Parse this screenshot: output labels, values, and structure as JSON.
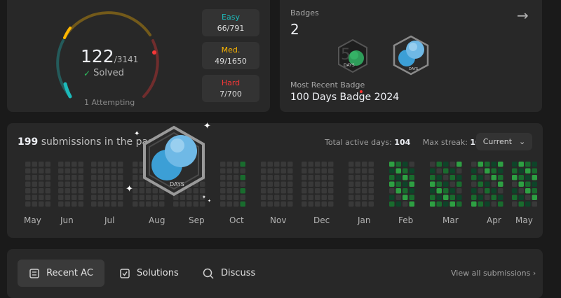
{
  "solved": {
    "count": "122",
    "total": "/3141",
    "label": "Solved",
    "attempting": "1 Attempting"
  },
  "difficulty": [
    {
      "label": "Easy",
      "value": "66/791",
      "color": "#1cbaba"
    },
    {
      "label": "Med.",
      "value": "49/1650",
      "color": "#ffb700"
    },
    {
      "label": "Hard",
      "value": "7/700",
      "color": "#f63737"
    }
  ],
  "badges": {
    "title": "Badges",
    "count": "2",
    "recent_label": "Most Recent Badge",
    "recent_name": "100 Days Badge 2024",
    "badge_text": "DAYS"
  },
  "calendar": {
    "count": "199",
    "text": "submissions in the past",
    "active_label": "Total active days:",
    "active_value": "104",
    "streak_label": "Max streak:",
    "streak_value": "101",
    "selector": "Current",
    "months": [
      "May",
      "Jun",
      "Jul",
      "Aug",
      "Sep",
      "Oct",
      "Nov",
      "Dec",
      "Jan",
      "Feb",
      "Mar",
      "Apr",
      "May"
    ]
  },
  "tabs": {
    "recent_ac": "Recent AC",
    "solutions": "Solutions",
    "discuss": "Discuss",
    "view_all": "View all submissions"
  },
  "colors": {
    "easy": "#1cbaba",
    "medium": "#ffb700",
    "hard": "#f63737",
    "heat_empty": "#393939",
    "heat_low": "#0e4429",
    "heat_mid": "#196c2e",
    "heat_high": "#2ea043"
  }
}
